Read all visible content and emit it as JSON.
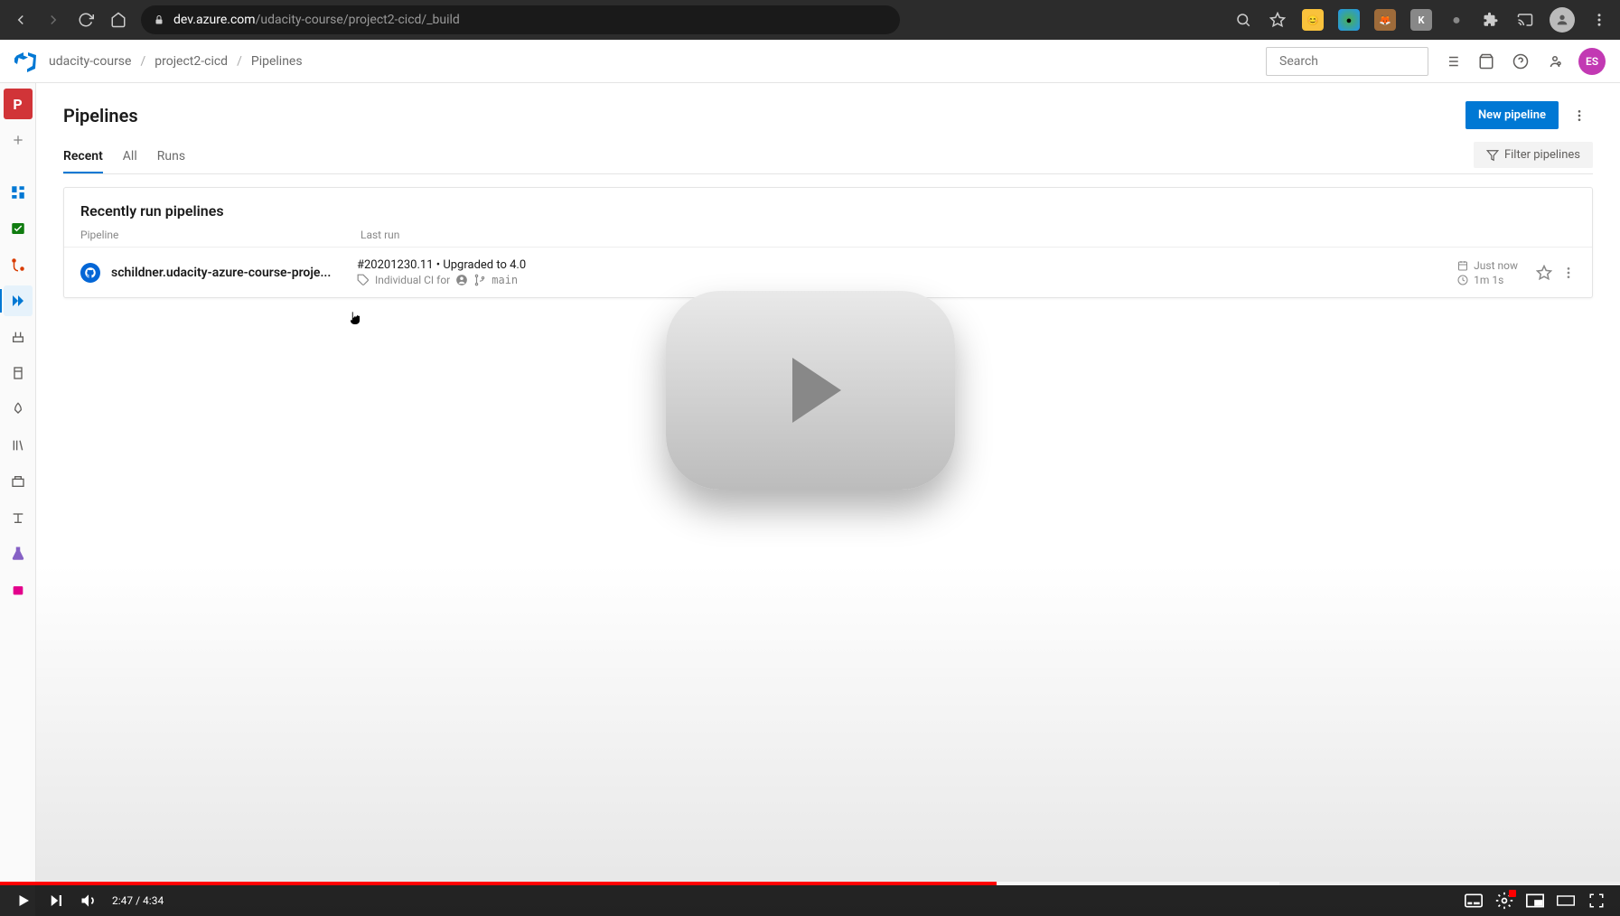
{
  "browser": {
    "url_host": "dev.azure.com",
    "url_path": "/udacity-course/project2-cicd/_build"
  },
  "breadcrumb": {
    "org": "udacity-course",
    "project": "project2-cicd",
    "page": "Pipelines"
  },
  "search": {
    "placeholder": "Search"
  },
  "page": {
    "title": "Pipelines",
    "new_pipeline_label": "New pipeline",
    "filter_label": "Filter pipelines"
  },
  "tabs": {
    "recent": "Recent",
    "all": "All",
    "runs": "Runs"
  },
  "card": {
    "title": "Recently run pipelines",
    "col_pipeline": "Pipeline",
    "col_last": "Last run"
  },
  "row": {
    "name": "schildner.udacity-azure-course-proje...",
    "run_top": "#20201230.11 • Upgraded to 4.0",
    "reason": "Individual CI for",
    "branch": "main",
    "time": "Just now",
    "duration": "1m 1s"
  },
  "user_initials": "ES",
  "video": {
    "current": "2:47",
    "total": "4:34"
  }
}
